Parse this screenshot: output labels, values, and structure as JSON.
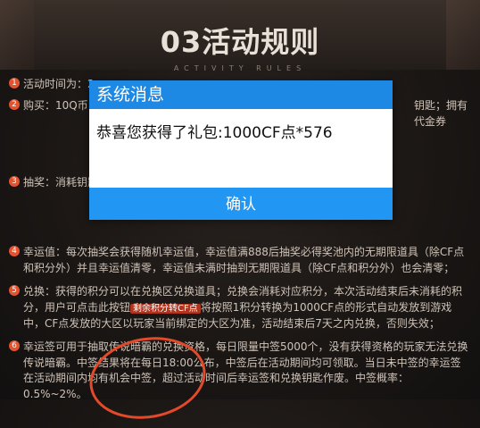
{
  "header": {
    "title": "03活动规则",
    "subtitle": "ACTIVITY RULES"
  },
  "rules": [
    {
      "num": "1",
      "text": "活动时间为：2"
    },
    {
      "num": "2",
      "text": "购买：10Q币 … 的玩家，可以 … 后无法退还（下 … 封号则不允许 …",
      "right1": "钥匙；拥有代金券",
      "right2": "一旦代金券使用后",
      "right3": "券）若玩家账号被"
    },
    {
      "num": "3",
      "text": "抽奖：消耗钥匙 … 或发往游戏仓 … 区）；唯一性",
      "right1": "可选择分解成钥匙",
      "right2": "入好绑定的大",
      "right3": "戏仓库无法重复到账；"
    },
    {
      "num": "4",
      "text": "幸运值：每次抽奖会获得随机幸运值，幸运值满888后抽奖必得奖池内的无期限道具（除CF点和积分外）并且幸运值清零，幸运值未满时抽到无期限道具（除CF点和积分外）也会清零；"
    },
    {
      "num": "5",
      "text1": "兑换：获得的积分可以在兑换区兑换道具；兑换会消耗对应积分，本次活动结束后未消耗的积分，用户可点击此按钮",
      "tag": "剩余积分转CF点",
      "text2": "将按照1积分转换为1000CF点的形式自动发放到游戏中，CF点发放的大区以玩家当前绑定的大区为准，活动结束后7天之内兑换，否则失效；"
    },
    {
      "num": "6",
      "text": "幸运签可用于抽取传说暗霸的兑换资格，每日限量中签5000个，没有获得资格的玩家无法兑换传说暗霸。中签结果将在每日18:00公布，中签后在活动期间均可领取。当日未中签的幸运签在活动期间内均有机会中签，超过活动时间后幸运签和兑换钥匙作废。中签概率：0.5%~2%。"
    }
  ],
  "dialog": {
    "title": "系统消息",
    "message": "恭喜您获得了礼包:1000CF点*576",
    "confirm": "确认"
  },
  "colors": {
    "dialog_header": "#1e88e5",
    "confirm_button": "#2196f3",
    "accent_red": "#e3532f"
  }
}
